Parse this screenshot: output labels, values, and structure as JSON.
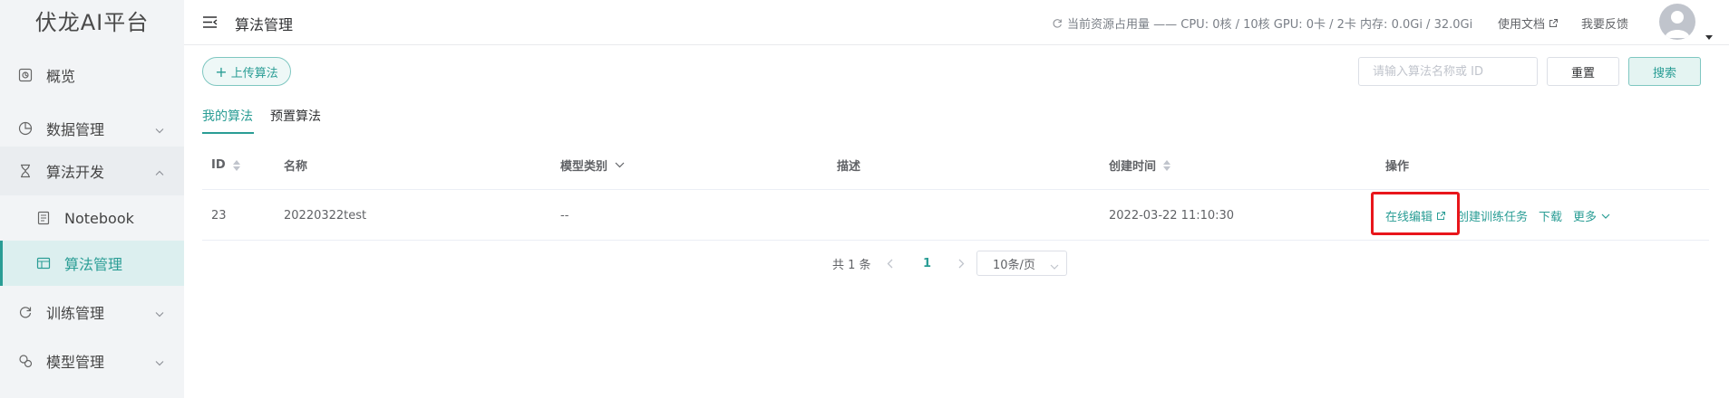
{
  "brand": "伏龙AI平台",
  "sidebar": {
    "items": [
      {
        "label": "概览",
        "icon": "overview-icon"
      },
      {
        "label": "数据管理",
        "icon": "data-icon"
      },
      {
        "label": "算法开发",
        "icon": "hourglass-icon"
      },
      {
        "label": "Notebook",
        "icon": "notebook-icon"
      },
      {
        "label": "算法管理",
        "icon": "algorithm-icon"
      },
      {
        "label": "训练管理",
        "icon": "train-icon"
      },
      {
        "label": "模型管理",
        "icon": "model-icon"
      }
    ]
  },
  "header": {
    "title": "算法管理",
    "resource_usage": "当前资源占用量 —— CPU: 0核 / 10核 GPU: 0卡 / 2卡 内存: 0.0Gi / 32.0Gi",
    "docs": "使用文档",
    "feedback": "我要反馈"
  },
  "toolbar": {
    "upload_label": "上传算法",
    "search_placeholder": "请输入算法名称或 ID",
    "reset_label": "重置",
    "search_label": "搜索"
  },
  "tabs": [
    {
      "label": "我的算法",
      "active": true
    },
    {
      "label": "预置算法",
      "active": false
    }
  ],
  "table": {
    "columns": [
      "ID",
      "名称",
      "模型类别",
      "描述",
      "创建时间",
      "操作"
    ],
    "rows": [
      {
        "id": "23",
        "name": "20220322test",
        "model_type": "--",
        "description": "",
        "created_at": "2022-03-22 11:10:30"
      }
    ],
    "actions": {
      "edit_online": "在线编辑",
      "create_task": "创建训练任务",
      "download": "下载",
      "more": "更多"
    }
  },
  "pagination": {
    "total": "共 1 条",
    "current_page": "1",
    "page_size": "10条/页"
  },
  "colors": {
    "accent": "#2a9d95",
    "highlight": "#e8161b",
    "sidebar_bg": "#f2f4f6"
  }
}
